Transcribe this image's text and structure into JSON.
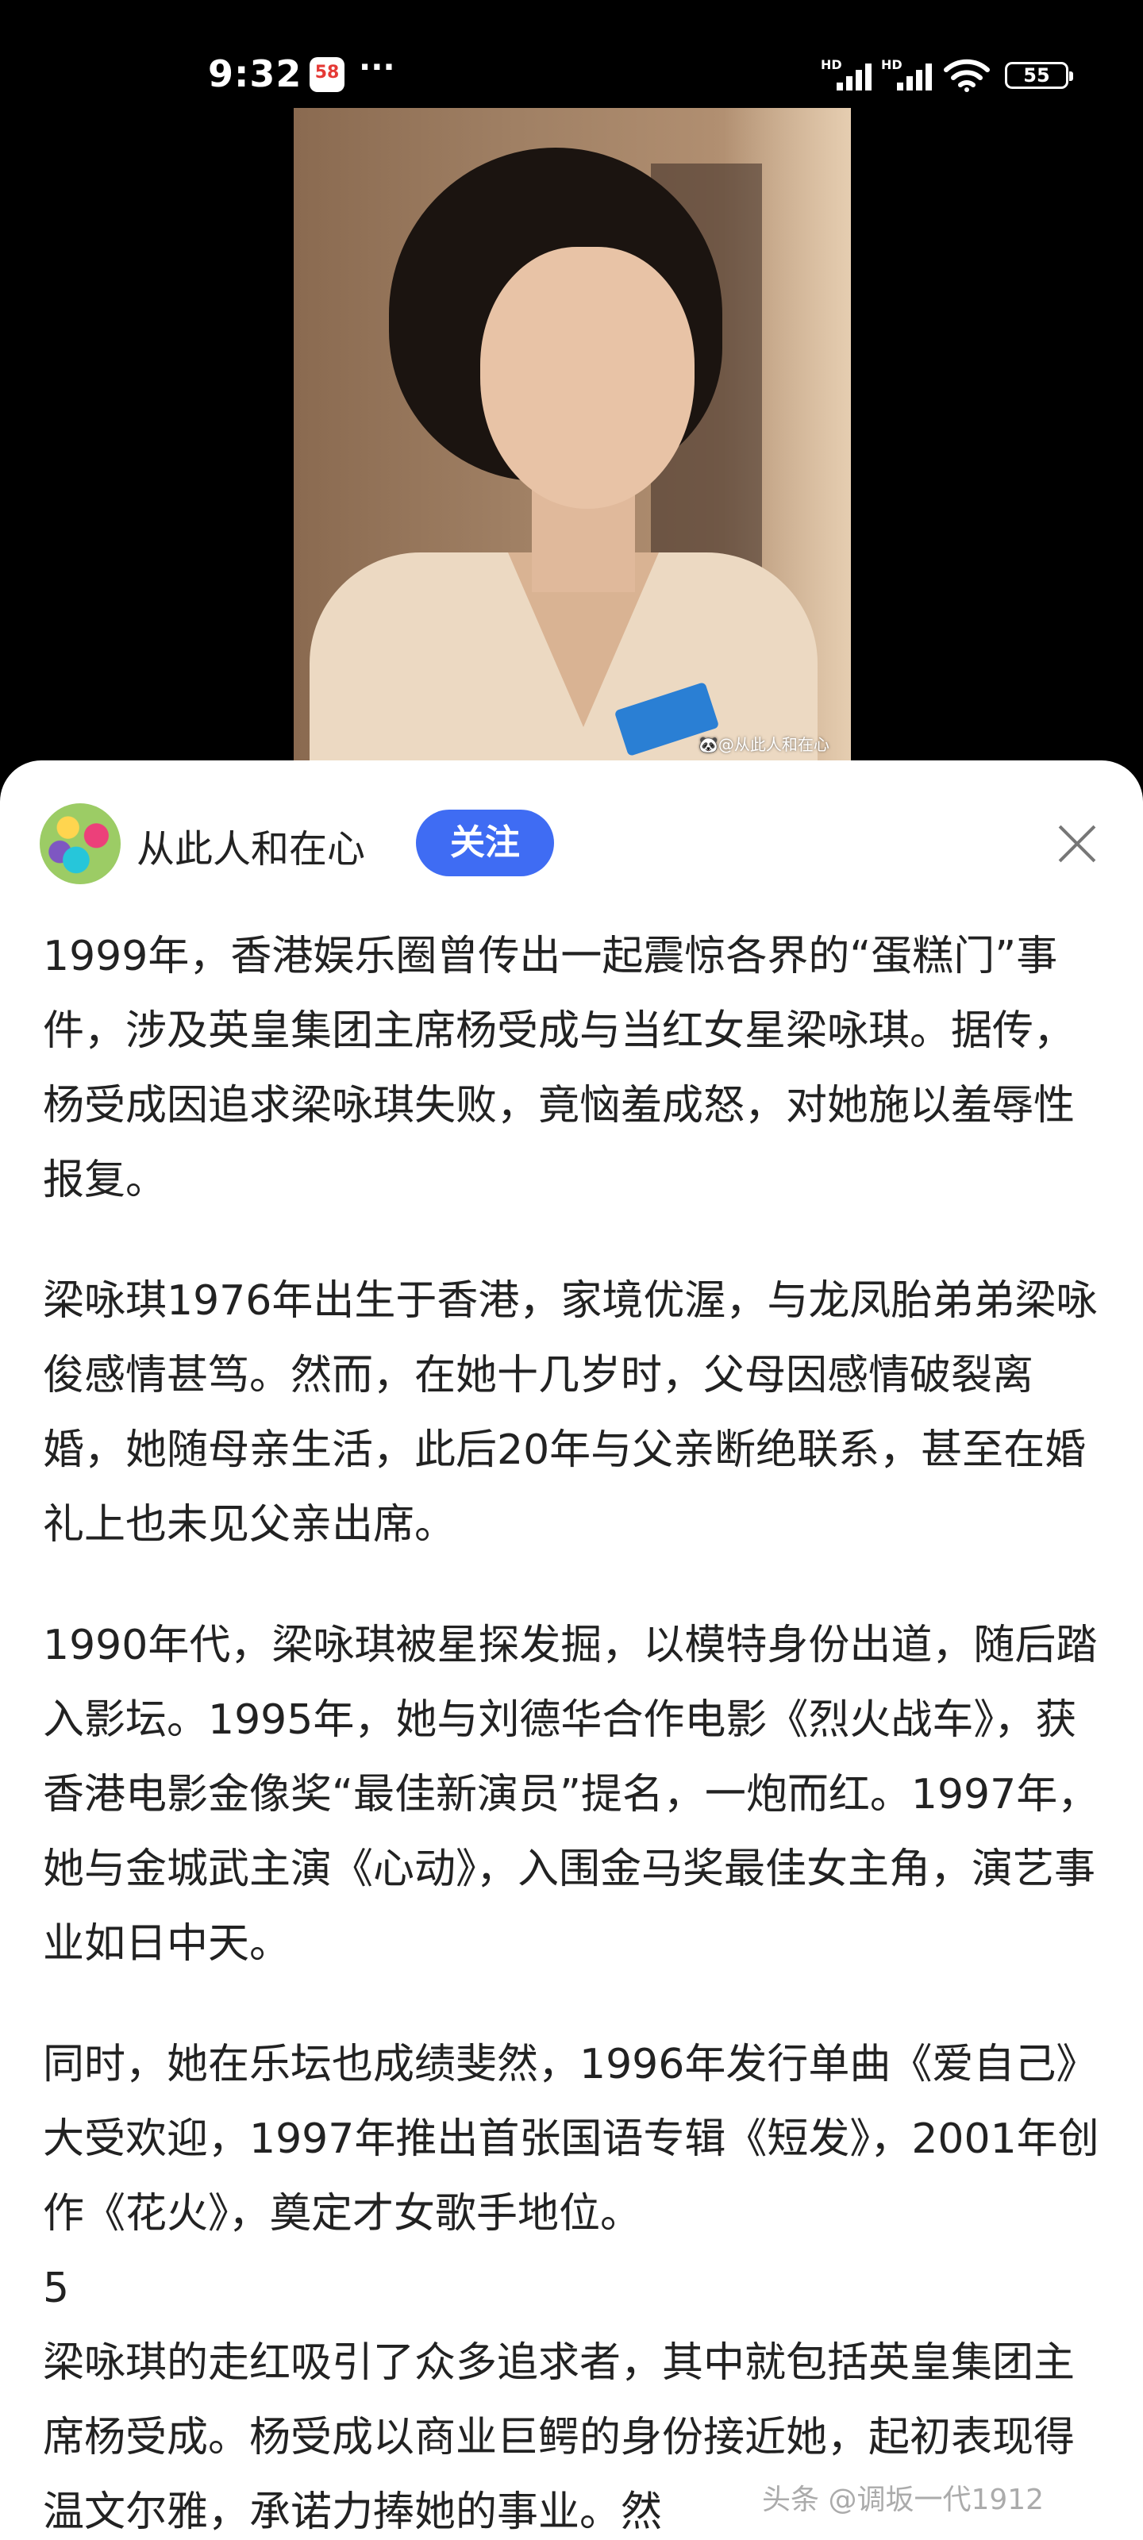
{
  "status_bar": {
    "time": "9:32",
    "app_badge": "58",
    "more": "···",
    "signal_labels": [
      "HD",
      "HD"
    ],
    "battery": "55"
  },
  "photo": {
    "watermark": "🐼@从此人和在心"
  },
  "author": {
    "name": "从此人和在心",
    "follow_label": "关注"
  },
  "article": {
    "paragraphs": [
      "1999年，香港娱乐圈曾传出一起震惊各界的“蛋糕门”事件，涉及英皇集团主席杨受成与当红女星梁咏琪。据传，杨受成因追求梁咏琪失败，竟恼羞成怒，对她施以羞辱性报复。",
      "梁咏琪1976年出生于香港，家境优渥，与龙凤胎弟弟梁咏俊感情甚笃。然而，在她十几岁时，父母因感情破裂离婚，她随母亲生活，此后20年与父亲断绝联系，甚至在婚礼上也未见父亲出席。",
      "1990年代，梁咏琪被星探发掘，以模特身份出道，随后踏入影坛。1995年，她与刘德华合作电影《烈火战车》，获香港电影金像奖“最佳新演员”提名，一炮而红。1997年，她与金城武主演《心动》，入围金马奖最佳女主角，演艺事业如日中天。",
      "同时，她在乐坛也成绩斐然，1996年发行单曲《爱自己》大受欢迎，1997年推出首张国语专辑《短发》，2001年创作《花火》，奠定才女歌手地位。",
      "5",
      "梁咏琪的走红吸引了众多追求者，其中就包括英皇集团主席杨受成。杨受成以商业巨鳄的身份接近她，起初表现得温文尔雅，承诺力捧她的事业。然"
    ]
  },
  "bottom_watermark": "头条 @调坂一代1912"
}
